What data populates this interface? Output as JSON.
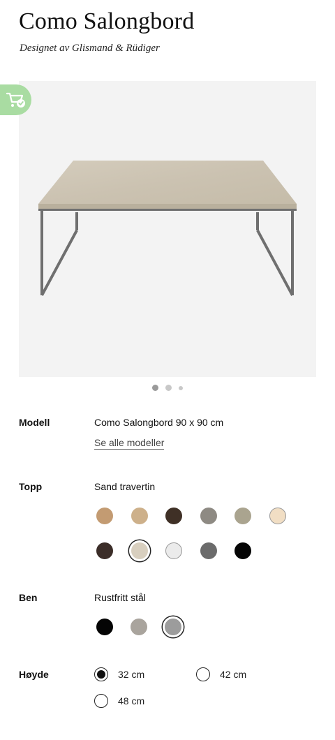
{
  "product": {
    "title": "Como Salongbord",
    "designer": "Designet av Glismand & Rüdiger"
  },
  "gallery": {
    "slides": 3,
    "active_index": 0
  },
  "icons": {
    "cart_badge": "cart-check-icon"
  },
  "options": {
    "model": {
      "label": "Modell",
      "value": "Como Salongbord 90 x 90 cm",
      "link": "Se alle modeller"
    },
    "top": {
      "label": "Topp",
      "value": "Sand travertin",
      "swatches": [
        {
          "color": "#c39b72",
          "selected": false
        },
        {
          "color": "#cdb08a",
          "selected": false
        },
        {
          "color": "#3f3026",
          "selected": false
        },
        {
          "color": "#8e8a83",
          "selected": false
        },
        {
          "color": "#aaa48f",
          "selected": false
        },
        {
          "color": "#f1dec4",
          "selected": false
        },
        {
          "color": "#3b2d28",
          "selected": false
        },
        {
          "color": "#d8cfbf",
          "selected": true
        },
        {
          "color": "#ebebeb",
          "selected": false
        },
        {
          "color": "#6b6b6b",
          "selected": false
        },
        {
          "color": "#050505",
          "selected": false
        }
      ]
    },
    "legs": {
      "label": "Ben",
      "value": "Rustfritt stål",
      "swatches": [
        {
          "color": "#050505",
          "selected": false
        },
        {
          "color": "#a9a49d",
          "selected": false
        },
        {
          "color": "#9c9c9c",
          "selected": true
        }
      ]
    },
    "height": {
      "label": "Høyde",
      "choices": [
        {
          "label": "32 cm",
          "selected": true
        },
        {
          "label": "42 cm",
          "selected": false
        },
        {
          "label": "48 cm",
          "selected": false
        }
      ]
    }
  }
}
